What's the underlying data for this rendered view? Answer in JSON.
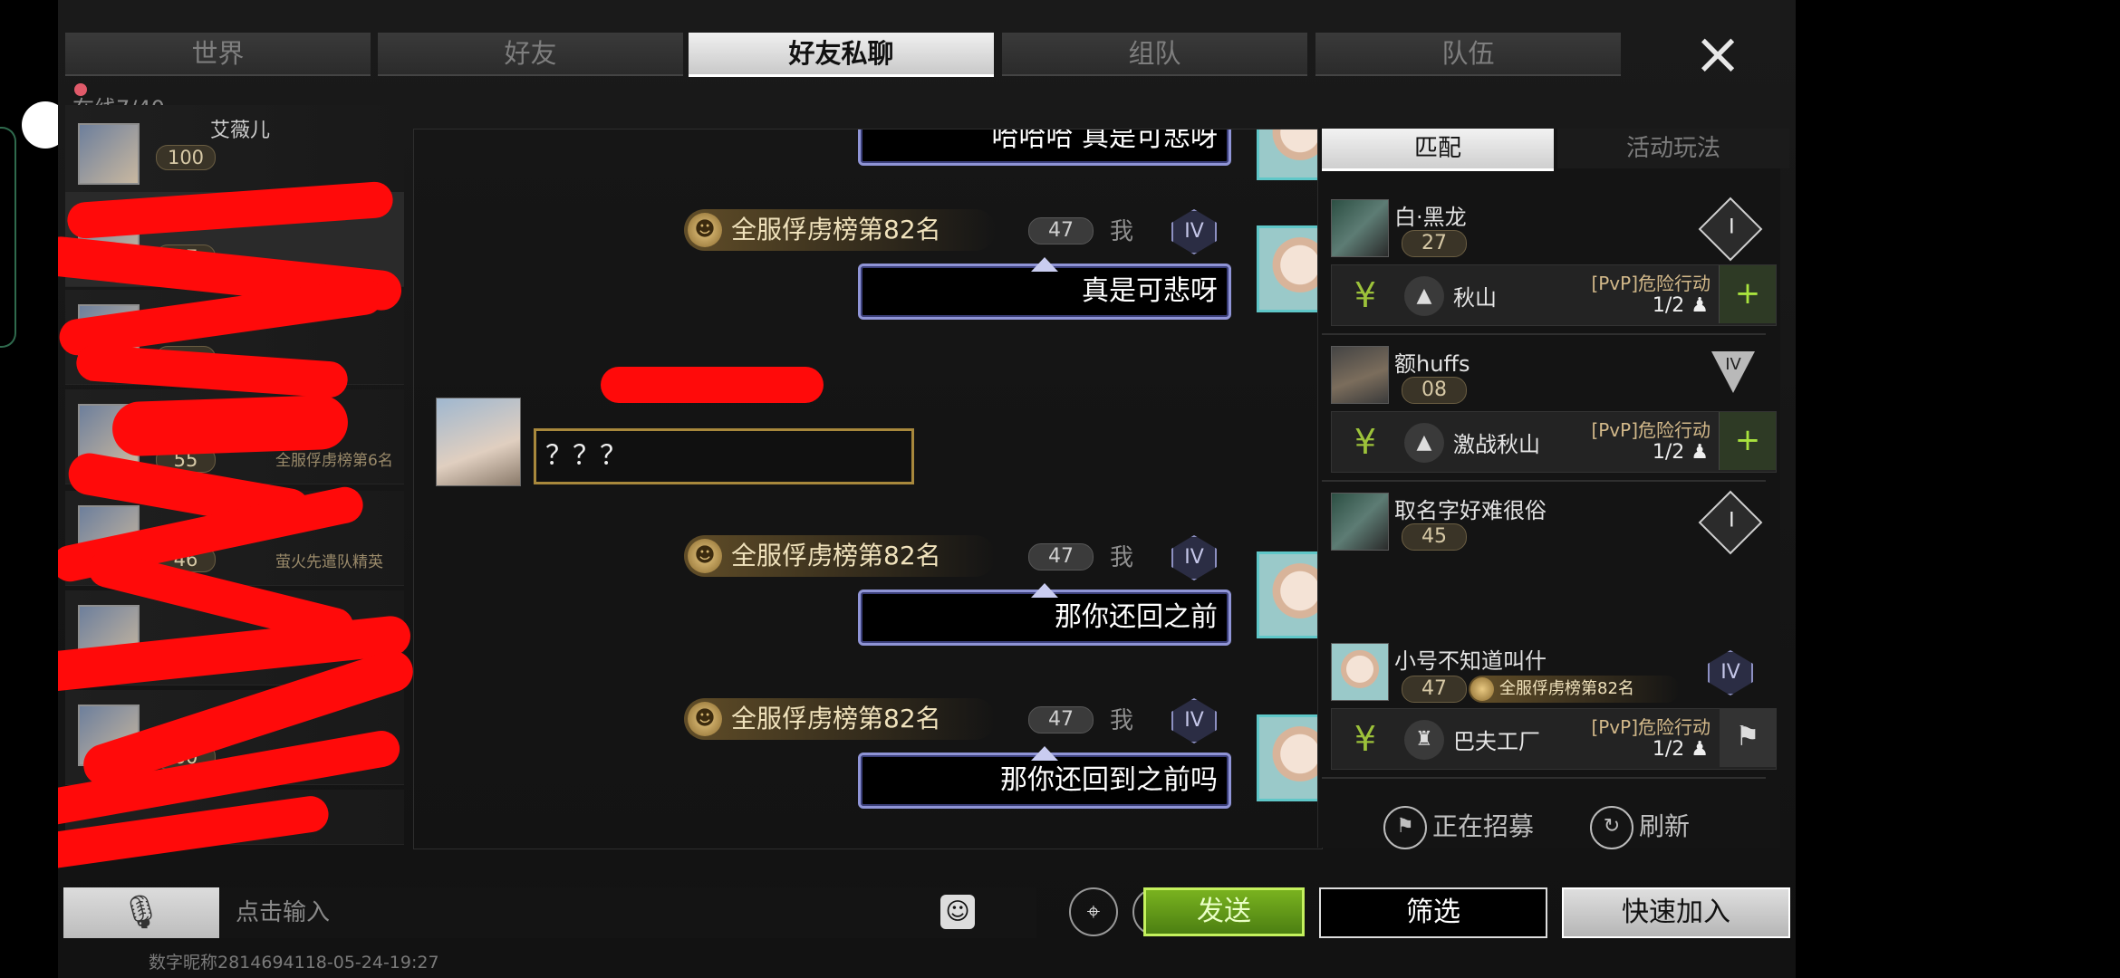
{
  "tabs": [
    {
      "label": "世界",
      "active": false
    },
    {
      "label": "好友",
      "active": false
    },
    {
      "label": "好友私聊",
      "active": true
    },
    {
      "label": "组队",
      "active": false
    },
    {
      "label": "队伍",
      "active": false
    }
  ],
  "close_icon": "×",
  "online_text": "在线7/40",
  "friends": [
    {
      "name": "艾薇儿",
      "level": "100",
      "badge": ""
    },
    {
      "name": "",
      "level": "37",
      "badge": ""
    },
    {
      "name": "",
      "level": "",
      "badge": ""
    },
    {
      "name": "",
      "level": "55",
      "badge": "全服俘虏榜第6名"
    },
    {
      "name": "",
      "level": "46",
      "badge": "萤火先遣队精英"
    },
    {
      "name": "",
      "level": "",
      "badge": ""
    },
    {
      "name": "",
      "level": "60",
      "badge": ""
    }
  ],
  "chat": {
    "top_partial_text": "哈哈哈 真是可悲呀",
    "messages": [
      {
        "side": "self",
        "rank": "全服俘虏榜第82名",
        "level": "47",
        "me": "我",
        "tier": "IV",
        "text": "真是可悲呀"
      },
      {
        "side": "other",
        "text": "？？？"
      },
      {
        "side": "self",
        "rank": "全服俘虏榜第82名",
        "level": "47",
        "me": "我",
        "tier": "IV",
        "text": "那你还回之前"
      },
      {
        "side": "self",
        "rank": "全服俘虏榜第82名",
        "level": "47",
        "me": "我",
        "tier": "IV",
        "text": "那你还回到之前吗"
      }
    ]
  },
  "right_panel": {
    "tabs": [
      {
        "label": "匹配",
        "active": true
      },
      {
        "label": "活动玩法",
        "active": false
      }
    ],
    "teams": [
      {
        "name": "白·黑龙",
        "level": "27",
        "tier": "I",
        "map": "秋山",
        "mode": "[PvP]危险行动",
        "count": "1/2",
        "action": "+"
      },
      {
        "name": "额huffs",
        "level": "08",
        "tier": "IV",
        "map": "激战秋山",
        "mode": "[PvP]危险行动",
        "count": "1/2",
        "action": "+"
      },
      {
        "name": "取名字好难很俗",
        "level": "45",
        "tier": "I"
      },
      {
        "name": "小号不知道叫什",
        "level": "47",
        "rank": "全服俘虏榜第82名",
        "tier": "IV",
        "map": "巴夫工厂",
        "mode": "[PvP]危险行动",
        "count": "1/2",
        "action": "flag"
      }
    ],
    "recruiting_label": "正在招募",
    "refresh_label": "刷新"
  },
  "bottom": {
    "input_placeholder": "点击输入",
    "send_label": "发送",
    "filter_label": "筛选",
    "quick_join_label": "快速加入",
    "footer": "数字昵称2814694118-05-24-19:27"
  }
}
